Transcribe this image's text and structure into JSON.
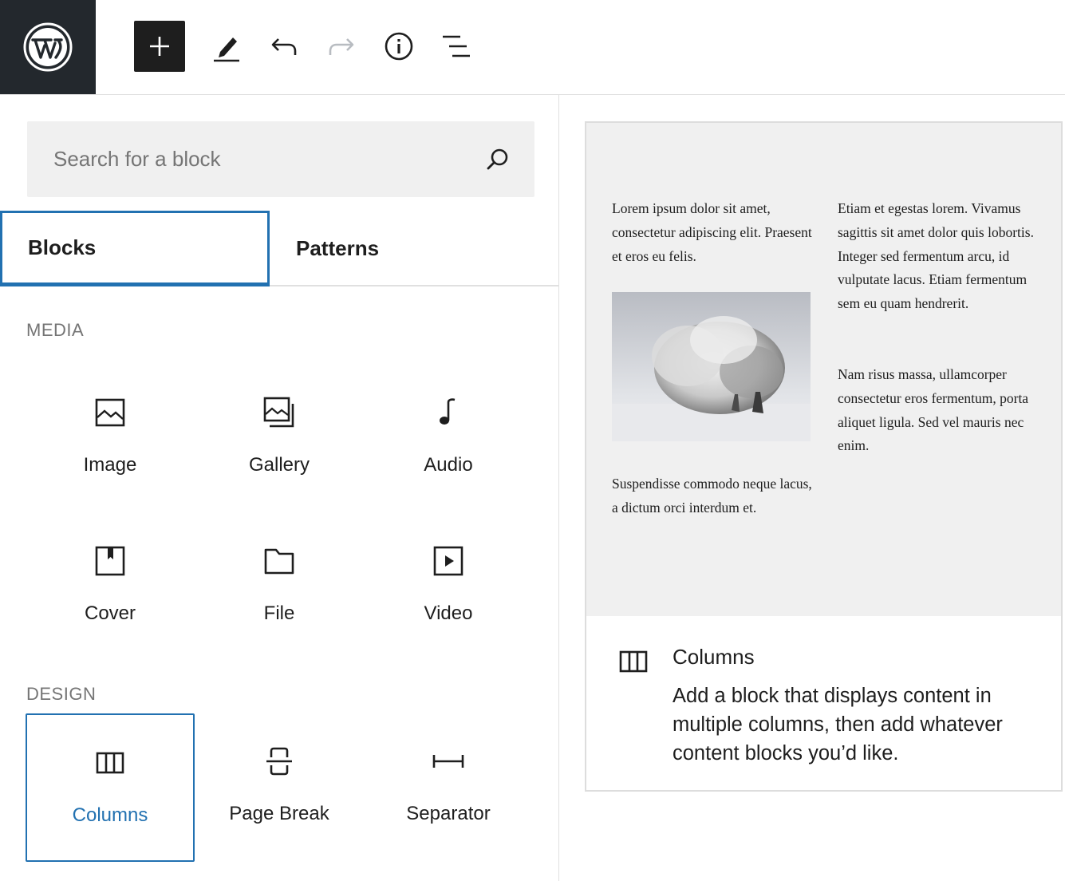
{
  "toolbar": {
    "logo_icon": "wordpress-logo-icon",
    "buttons": [
      {
        "name": "add-block-button",
        "icon": "plus-icon"
      },
      {
        "name": "edit-tools-button",
        "icon": "pencil-icon"
      },
      {
        "name": "undo-button",
        "icon": "undo-icon"
      },
      {
        "name": "redo-button",
        "icon": "redo-icon"
      },
      {
        "name": "details-button",
        "icon": "info-icon"
      },
      {
        "name": "list-view-button",
        "icon": "list-view-icon"
      }
    ]
  },
  "search": {
    "placeholder": "Search for a block",
    "icon": "search-icon"
  },
  "tabs": {
    "blocks": "Blocks",
    "patterns": "Patterns",
    "active": "Blocks"
  },
  "sections": {
    "media": {
      "title": "MEDIA",
      "items": [
        {
          "label": "Image",
          "icon": "image-icon"
        },
        {
          "label": "Gallery",
          "icon": "gallery-icon"
        },
        {
          "label": "Audio",
          "icon": "audio-icon"
        },
        {
          "label": "Cover",
          "icon": "cover-icon"
        },
        {
          "label": "File",
          "icon": "file-icon"
        },
        {
          "label": "Video",
          "icon": "video-icon"
        }
      ]
    },
    "design": {
      "title": "DESIGN",
      "items": [
        {
          "label": "Columns",
          "icon": "columns-icon",
          "selected": true
        },
        {
          "label": "Page Break",
          "icon": "page-break-icon"
        },
        {
          "label": "Separator",
          "icon": "separator-icon"
        }
      ]
    }
  },
  "preview": {
    "col1_para1": "Lorem ipsum dolor sit amet, consectetur adipiscing elit. Praesent et eros eu felis.",
    "col1_para2": "Suspendisse commodo neque lacus, a dictum orci interdum et.",
    "col2_para1": "Etiam et egestas lorem. Vivamus sagittis sit amet dolor quis lobortis. Integer sed fermentum arcu, id vulputate lacus. Etiam fermentum sem eu quam hendrerit.",
    "col2_para2": "Nam risus massa, ullamcorper consectetur eros fermentum, porta aliquet ligula. Sed vel mauris nec enim.",
    "image_subject": "snow-covered-tree-image"
  },
  "card": {
    "icon": "columns-icon",
    "title": "Columns",
    "description": "Add a block that displays content in multiple columns, then add whatever content blocks you’d like."
  },
  "colors": {
    "accent": "#2271b1",
    "toolbar_dark": "#23282d",
    "button_dark": "#1e1e1e",
    "muted_text": "#757575",
    "panel_bg": "#f0f0f0"
  }
}
